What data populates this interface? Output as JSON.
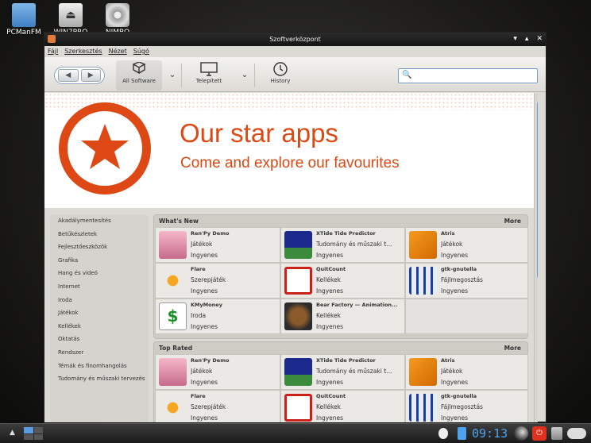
{
  "desktop": {
    "icons": [
      {
        "label": "PCManFM"
      },
      {
        "label": "WIN7PRO"
      },
      {
        "label": "NIMBO"
      }
    ]
  },
  "window": {
    "title": "Szoftverközpont",
    "buttons": [
      "▾",
      "▴",
      "✕"
    ]
  },
  "menubar": {
    "items": [
      "Fájl",
      "Szerkesztés",
      "Nézet",
      "Súgó"
    ]
  },
  "toolbar": {
    "all_software": "All Software",
    "installed": "Telepített",
    "history": "History",
    "search_placeholder": ""
  },
  "banner": {
    "title": "Our star apps",
    "subtitle": "Come and explore our favourites"
  },
  "sidebar": {
    "categories": [
      "Akadálymentesítés",
      "Betűkészletek",
      "Fejlesztőeszközök",
      "Grafika",
      "Hang és videó",
      "Internet",
      "Iroda",
      "Játékok",
      "Kellékek",
      "Oktatás",
      "Rendszer",
      "Témák és finomhangolás",
      "Tudomány és műszaki tervezés"
    ]
  },
  "whats_new": {
    "title": "What's New",
    "more": "More",
    "apps": [
      {
        "name": "Ren'Py Demo",
        "category": "Játékok",
        "price": "Ingyenes",
        "icon": "anime-girl-icon"
      },
      {
        "name": "XTide Tide Predictor",
        "category": "Tudomány és műszaki t...",
        "price": "Ingyenes",
        "icon": "tide-night-icon"
      },
      {
        "name": "Atris",
        "category": "Játékok",
        "price": "Ingyenes",
        "icon": "atris-icon"
      },
      {
        "name": "Flare",
        "category": "Szerepjáték",
        "price": "Ingyenes",
        "icon": "flare-icon"
      },
      {
        "name": "QuitCount",
        "category": "Kellékek",
        "price": "Ingyenes",
        "icon": "no-smoking-icon"
      },
      {
        "name": "gtk-gnutella",
        "category": "Fájlmegosztás",
        "price": "Ingyenes",
        "icon": "gnutella-icon"
      },
      {
        "name": "KMyMoney",
        "category": "Iroda",
        "price": "Ingyenes",
        "icon": "money-document-icon"
      },
      {
        "name": "Bear Factory — Animation...",
        "category": "Kellékek",
        "price": "Ingyenes",
        "icon": "bear-icon"
      }
    ]
  },
  "top_rated": {
    "title": "Top Rated",
    "more": "More",
    "apps": [
      {
        "name": "Ren'Py Demo",
        "category": "Játékok",
        "price": "Ingyenes",
        "icon": "anime-girl-icon"
      },
      {
        "name": "XTide Tide Predictor",
        "category": "Tudomány és műszaki t...",
        "price": "Ingyenes",
        "icon": "tide-night-icon"
      },
      {
        "name": "Atris",
        "category": "Játékok",
        "price": "Ingyenes",
        "icon": "atris-icon"
      },
      {
        "name": "Flare",
        "category": "Szerepjáték",
        "price": "Ingyenes",
        "icon": "flare-icon"
      },
      {
        "name": "QuitCount",
        "category": "Kellékek",
        "price": "Ingyenes",
        "icon": "no-smoking-icon"
      },
      {
        "name": "gtk-gnutella",
        "category": "Fájlmegosztás",
        "price": "Ingyenes",
        "icon": "gnutella-icon"
      }
    ]
  },
  "taskbar": {
    "clock": "09:13"
  },
  "colors": {
    "accent": "#dd4814",
    "scroll": "#6a9ad4"
  }
}
